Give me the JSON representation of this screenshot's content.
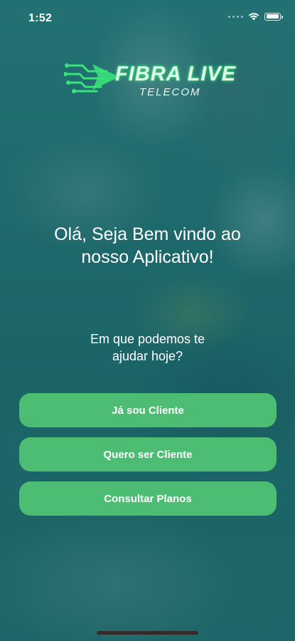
{
  "status_bar": {
    "time": "1:52",
    "icons": [
      "signal-icon",
      "wifi-icon",
      "battery-icon"
    ]
  },
  "brand": {
    "name": "FIBRA LIVE",
    "tagline": "TELECOM",
    "accent_color": "#39e27a"
  },
  "welcome": {
    "title_line1": "Olá, Seja Bem vindo ao",
    "title_line2": "nosso Aplicativo!",
    "prompt_line1": "Em que podemos te",
    "prompt_line2": "ajudar hoje?"
  },
  "actions": {
    "existing_client": "Já sou Cliente",
    "become_client": "Quero ser Cliente",
    "view_plans": "Consultar Planos"
  },
  "colors": {
    "background": "#1f6e70",
    "button": "#4dbd73",
    "text": "#ffffff"
  }
}
